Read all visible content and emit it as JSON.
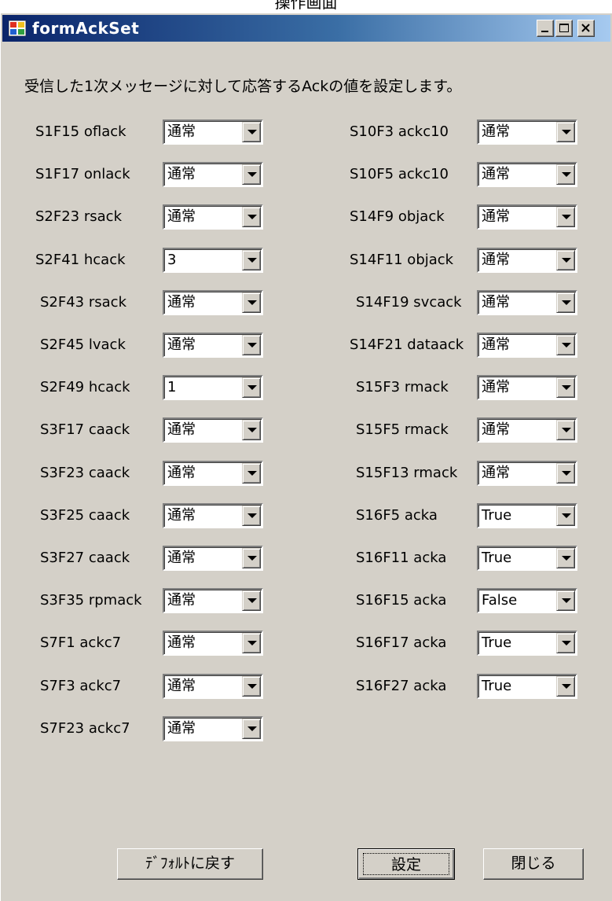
{
  "page_caption": "操作画面",
  "window": {
    "title": "formAckSet",
    "instruction": "受信した1次メッセージに対して応答するAckの値を設定します。"
  },
  "left_fields": [
    {
      "label": "S1F15 oflack",
      "value": "通常"
    },
    {
      "label": "S1F17 onlack",
      "value": "通常"
    },
    {
      "label": "S2F23 rsack",
      "value": "通常"
    },
    {
      "label": "S2F41 hcack",
      "value": "3"
    },
    {
      "label": "S2F43 rsack",
      "value": "通常"
    },
    {
      "label": "S2F45 lvack",
      "value": "通常"
    },
    {
      "label": "S2F49 hcack",
      "value": "1"
    },
    {
      "label": "S3F17 caack",
      "value": "通常"
    },
    {
      "label": "S3F23 caack",
      "value": "通常"
    },
    {
      "label": "S3F25 caack",
      "value": "通常"
    },
    {
      "label": "S3F27 caack",
      "value": "通常"
    },
    {
      "label": "S3F35 rpmack",
      "value": "通常"
    },
    {
      "label": "S7F1 ackc7",
      "value": "通常"
    },
    {
      "label": "S7F3 ackc7",
      "value": "通常"
    },
    {
      "label": "S7F23 ackc7",
      "value": "通常"
    }
  ],
  "right_fields": [
    {
      "label": "S10F3 ackc10",
      "value": "通常"
    },
    {
      "label": "S10F5 ackc10",
      "value": "通常"
    },
    {
      "label": "S14F9 objack",
      "value": "通常"
    },
    {
      "label": "S14F11 objack",
      "value": "通常"
    },
    {
      "label": "S14F19 svcack",
      "value": "通常"
    },
    {
      "label": "S14F21 dataack",
      "value": "通常"
    },
    {
      "label": "S15F3 rmack",
      "value": "通常"
    },
    {
      "label": "S15F5 rmack",
      "value": "通常"
    },
    {
      "label": "S15F13 rmack",
      "value": "通常"
    },
    {
      "label": "S16F5 acka",
      "value": "True"
    },
    {
      "label": "S16F11 acka",
      "value": "True"
    },
    {
      "label": "S16F15 acka",
      "value": "False"
    },
    {
      "label": "S16F17 acka",
      "value": "True"
    },
    {
      "label": "S16F27 acka",
      "value": "True"
    }
  ],
  "buttons": {
    "reset_default": "ﾃﾞﾌｫﾙﾄに戻す",
    "set": "設定",
    "close": "閉じる"
  },
  "colors": {
    "titlebar_start": "#0a246a",
    "titlebar_end": "#a6caf0",
    "face": "#d4d0c8"
  },
  "icons": [
    "app-icon",
    "minimize-icon",
    "maximize-icon",
    "close-icon",
    "dropdown-arrow-icon"
  ]
}
